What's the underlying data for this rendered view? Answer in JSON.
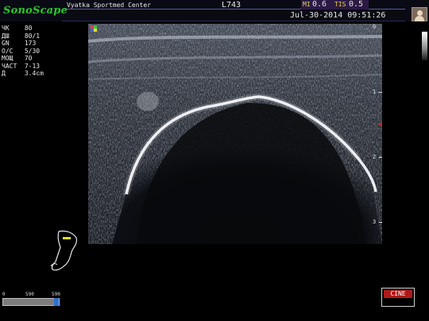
{
  "header": {
    "brand": "SonoScape",
    "hospital": "Vyatka Sportmed Center",
    "probe": "L743",
    "mi_label": "MI",
    "mi_value": "0.6",
    "tis_label": "TIS",
    "tis_value": "0.5",
    "datetime": "Jul-30-2014 09:51:26"
  },
  "params": [
    {
      "label": "ЧК",
      "value": "80"
    },
    {
      "label": "ДШ",
      "value": "80/1"
    },
    {
      "label": "GN",
      "value": "173"
    },
    {
      "label": "О/С",
      "value": "5/30"
    },
    {
      "label": "МОЩ",
      "value": "70"
    },
    {
      "label": "ЧАСТ",
      "value": "7-13"
    },
    {
      "label": "Д",
      "value": "3.4cm"
    }
  ],
  "depth_scale": [
    "0",
    "1",
    "2",
    "3"
  ],
  "bottom": {
    "scale_min": "0",
    "scale_mid": "590",
    "scale_max": "590",
    "cine_label": "CINE"
  },
  "colors": {
    "brand_green": "#2cc52c",
    "index_label": "#e3d34b",
    "cine_red": "#b01818"
  },
  "icons": [
    "profile-icon",
    "body-mark-arm-icon",
    "focus-marker-icon",
    "gray-scale-bar"
  ]
}
